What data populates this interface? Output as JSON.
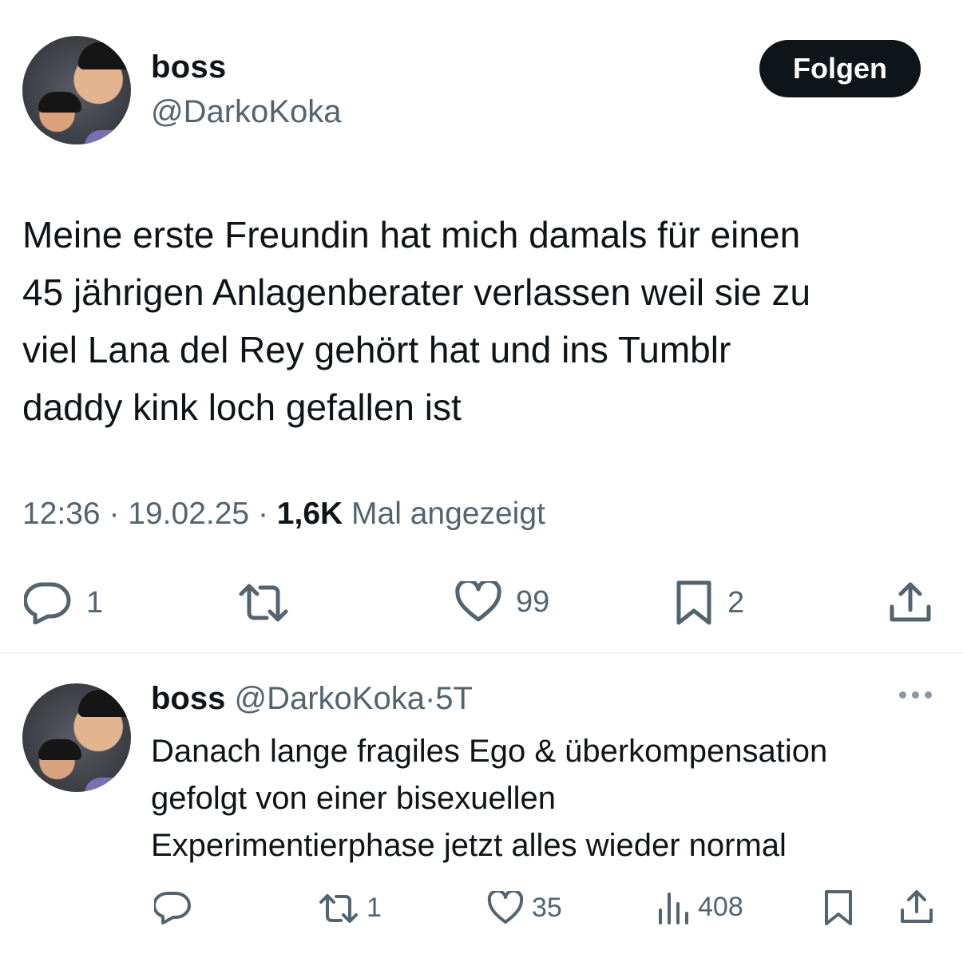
{
  "tweet": {
    "display_name": "boss",
    "handle": "@DarkoKoka",
    "follow_label": "Folgen",
    "text": "Meine erste Freundin hat mich damals für einen\n45 jährigen Anlagenberater verlassen weil sie zu\nviel Lana del Rey gehört hat und ins Tumblr\ndaddy kink loch gefallen ist",
    "time": "12:36",
    "date": "19.02.25",
    "sep": "·",
    "views_count": "1,6K",
    "views_label": "Mal angezeigt",
    "actions": {
      "replies": "1",
      "reposts": "",
      "likes": "99",
      "bookmarks": "2"
    }
  },
  "reply": {
    "display_name": "boss",
    "handle": "@DarkoKoka",
    "sep": "·",
    "age": "5T",
    "text": "Danach lange fragiles Ego & überkompensation\ngefolgt von einer bisexuellen\nExperimentierphase jetzt alles wieder normal",
    "actions": {
      "replies": "",
      "reposts": "1",
      "likes": "35",
      "views": "408"
    }
  },
  "colors": {
    "text_primary": "#0f1419",
    "text_secondary": "#536471",
    "button_bg": "#0f1419",
    "divider": "#eff3f4"
  },
  "icons": [
    "reply-icon",
    "repost-icon",
    "like-icon",
    "bookmark-icon",
    "share-icon",
    "views-icon",
    "more-icon"
  ]
}
